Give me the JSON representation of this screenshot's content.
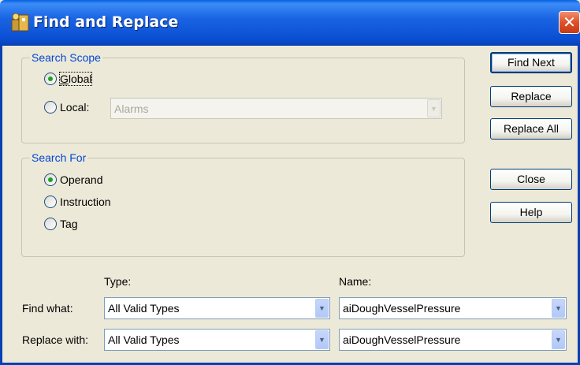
{
  "window": {
    "title": "Find and Replace",
    "close_glyph": "✕",
    "icon": "app-icon"
  },
  "search_scope": {
    "legend": "Search Scope",
    "global": {
      "label": "Global",
      "checked": true
    },
    "local": {
      "label": "Local:",
      "checked": false
    },
    "local_value": "Alarms"
  },
  "search_for": {
    "legend": "Search For",
    "options": [
      {
        "label": "Operand",
        "checked": true
      },
      {
        "label": "Instruction",
        "checked": false
      },
      {
        "label": "Tag",
        "checked": false
      }
    ]
  },
  "buttons": {
    "find_next": "Find Next",
    "replace": "Replace",
    "replace_all": "Replace All",
    "close": "Close",
    "help": "Help"
  },
  "fields": {
    "type_header": "Type:",
    "name_header": "Name:",
    "find_what": {
      "label": "Find what:",
      "type": "All Valid Types",
      "name": "aiDoughVesselPressure"
    },
    "replace_with": {
      "label": "Replace with:",
      "type": "All Valid Types",
      "name": "aiDoughVesselPressure"
    }
  },
  "colors": {
    "titlebar": "#0a4fd3",
    "legend": "#0046d5",
    "radio_dot": "#21a121",
    "close": "#e0502a"
  }
}
